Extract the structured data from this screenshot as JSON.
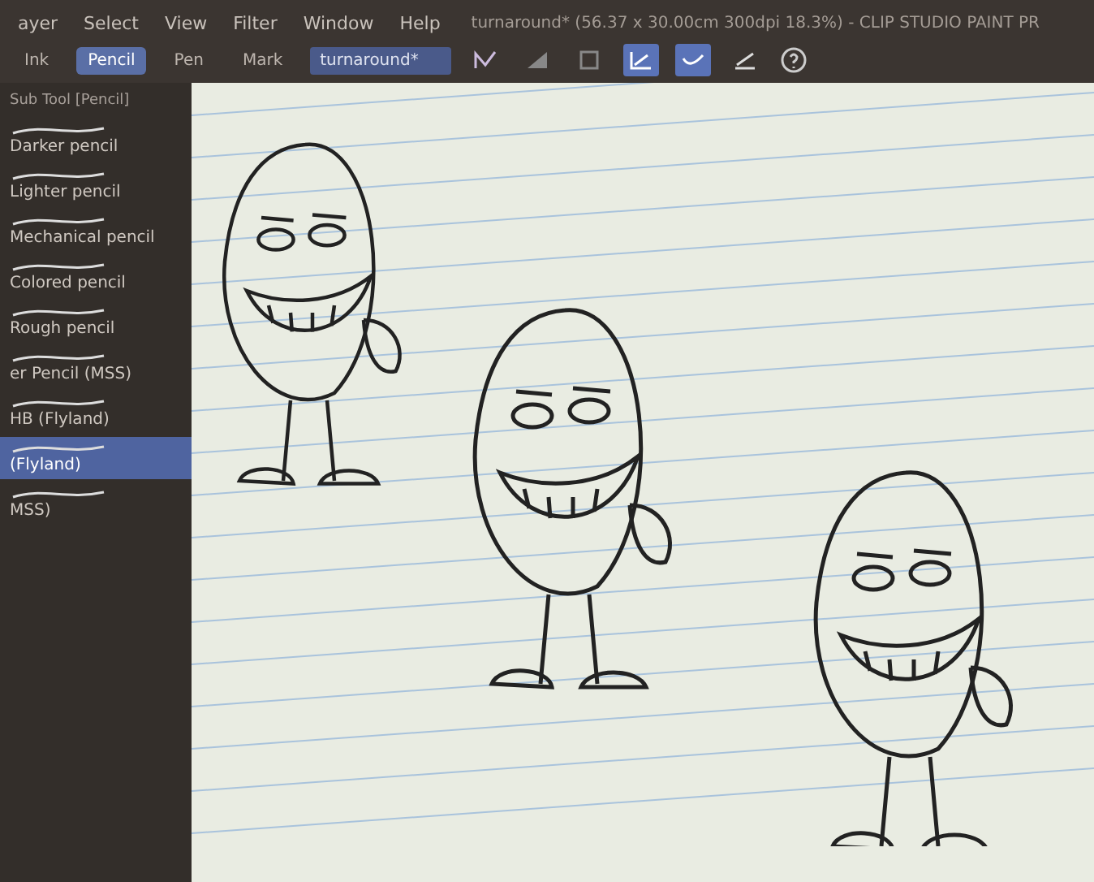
{
  "menu": [
    "ayer",
    "Select",
    "View",
    "Filter",
    "Window",
    "Help"
  ],
  "window_title": "turnaround* (56.37 x 30.00cm 300dpi 18.3%)  - CLIP STUDIO PAINT PR",
  "subtool_title": "Sub Tool [Pencil]",
  "subtool_tabs": [
    {
      "label": "Ink",
      "selected": false
    },
    {
      "label": "Pencil",
      "selected": true
    },
    {
      "label": "Pen",
      "selected": false
    },
    {
      "label": "Mark",
      "selected": false
    }
  ],
  "document_dropdown": "turnaround*",
  "toolbar_tools": [
    {
      "selected": false
    },
    {
      "selected": false
    },
    {
      "selected": false
    },
    {
      "selected": true
    },
    {
      "selected": true
    },
    {
      "selected": false
    }
  ],
  "brushes": [
    {
      "label": "Darker pencil",
      "selected": false
    },
    {
      "label": "Lighter pencil",
      "selected": false
    },
    {
      "label": "Mechanical pencil",
      "selected": false
    },
    {
      "label": "Colored pencil",
      "selected": false
    },
    {
      "label": "Rough pencil",
      "selected": false
    },
    {
      "label": "er Pencil (MSS)",
      "selected": false
    },
    {
      "label": "HB (Flyland)",
      "selected": false
    },
    {
      "label": "(Flyland)",
      "selected": true
    },
    {
      "label": "MSS)",
      "selected": false
    }
  ]
}
